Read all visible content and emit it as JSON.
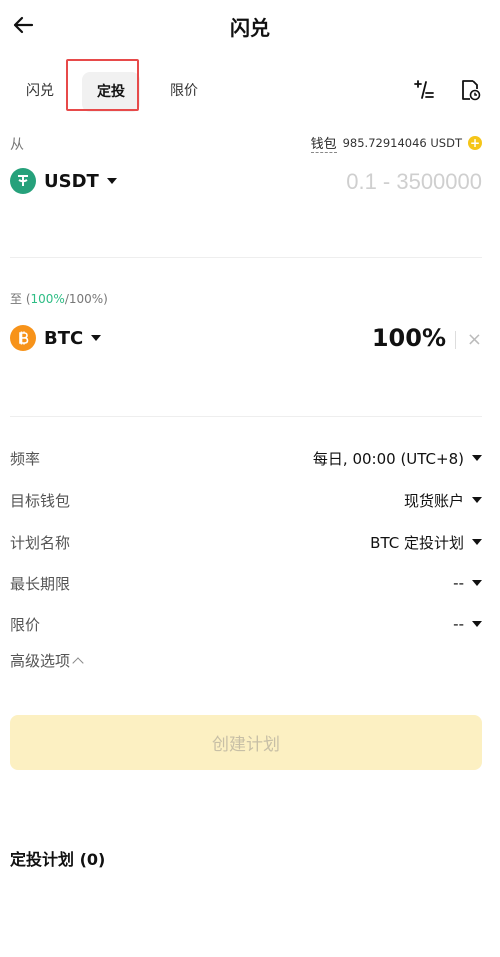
{
  "header": {
    "title": "闪兑",
    "back_icon": "arrow-left-icon"
  },
  "tabs": [
    {
      "label": "闪兑",
      "active": false
    },
    {
      "label": "定投",
      "active": true
    },
    {
      "label": "限价",
      "active": false
    }
  ],
  "toolbar": {
    "calc_icon": "calculator-icon",
    "history_icon": "history-icon"
  },
  "from": {
    "label": "从",
    "wallet_label": "钱包",
    "wallet_balance": "985.72914046 USDT",
    "coin": "USDT",
    "coin_color": "#26a17b",
    "amount_placeholder": "0.1 - 3500000"
  },
  "to": {
    "label_prefix": "至 (",
    "label_green": "100%",
    "label_suffix": "/100%)",
    "coin": "BTC",
    "coin_color": "#f7931a",
    "percent": "100%",
    "clear_icon": "×"
  },
  "settings": [
    {
      "label": "频率",
      "value": "每日, 00:00 (UTC+8)"
    },
    {
      "label": "目标钱包",
      "value": "现货账户"
    },
    {
      "label": "计划名称",
      "value": "BTC 定投计划"
    },
    {
      "label": "最长期限",
      "value": "--"
    },
    {
      "label": "限价",
      "value": "--"
    }
  ],
  "advanced_label": "高级选项",
  "create_button": "创建计划",
  "plans_title": "定投计划 (0)",
  "colors": {
    "accent_green": "#2ebd85",
    "button_bg": "#fcf0c2",
    "highlight": "#e74a4a"
  }
}
